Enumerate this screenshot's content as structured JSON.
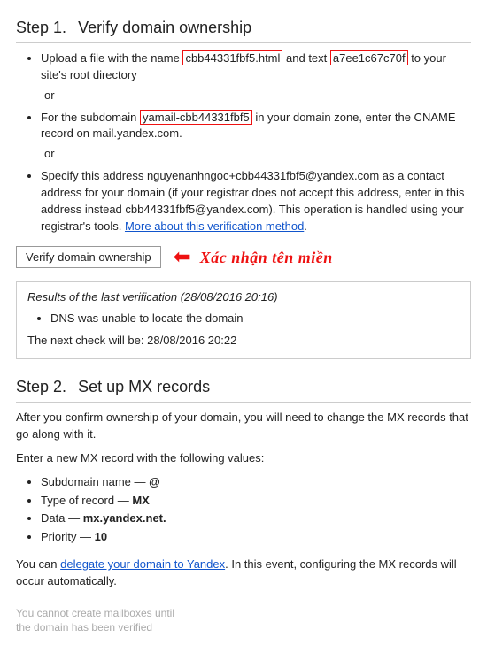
{
  "step1": {
    "heading_prefix": "Step 1.",
    "heading_title": "Verify domain ownership",
    "opt1_a": "Upload a file with the name ",
    "opt1_hl1": "cbb44331fbf5.html",
    "opt1_b": " and text ",
    "opt1_hl2": "a7ee1c67c70f",
    "opt1_c": " to your site's root directory",
    "or": "or",
    "opt2_a": "For the subdomain ",
    "opt2_hl": "yamail-cbb44331fbf5",
    "opt2_b": " in your domain zone, enter the CNAME record on mail.yandex.com.",
    "opt3_a": "Specify this address nguyenanhngoc+cbb44331fbf5@yandex.com as a contact address for your domain (if your registrar does not accept this address, enter in this address instead cbb44331fbf5@yandex.com). This operation is handled using your registrar's tools. ",
    "opt3_link": "More about this verification method",
    "opt3_b": ".",
    "button": "Verify domain ownership",
    "annotation": "Xác nhận tên miền",
    "results_title": "Results of the last verification (28/08/2016 20:16)",
    "results_item": "DNS was unable to locate the domain",
    "results_next": "The next check will be: 28/08/2016 20:22"
  },
  "step2": {
    "heading_prefix": "Step 2.",
    "heading_title": "Set up MX records",
    "intro": "After you confirm ownership of your domain, you will need to change the MX records that go along with it.",
    "enter": "Enter a new MX record with the following values:",
    "mx": [
      {
        "k": "Subdomain name — ",
        "v": "@"
      },
      {
        "k": "Type of record — ",
        "v": "MX"
      },
      {
        "k": "Data — ",
        "v": "mx.yandex.net."
      },
      {
        "k": "Priority — ",
        "v": "10"
      }
    ],
    "deleg_a": "You can ",
    "deleg_link": "delegate your domain to Yandex",
    "deleg_b": ". In this event, configuring the MX records will occur automatically."
  },
  "footer": {
    "l1": "You cannot create mailboxes until",
    "l2": "the domain has been verified"
  }
}
